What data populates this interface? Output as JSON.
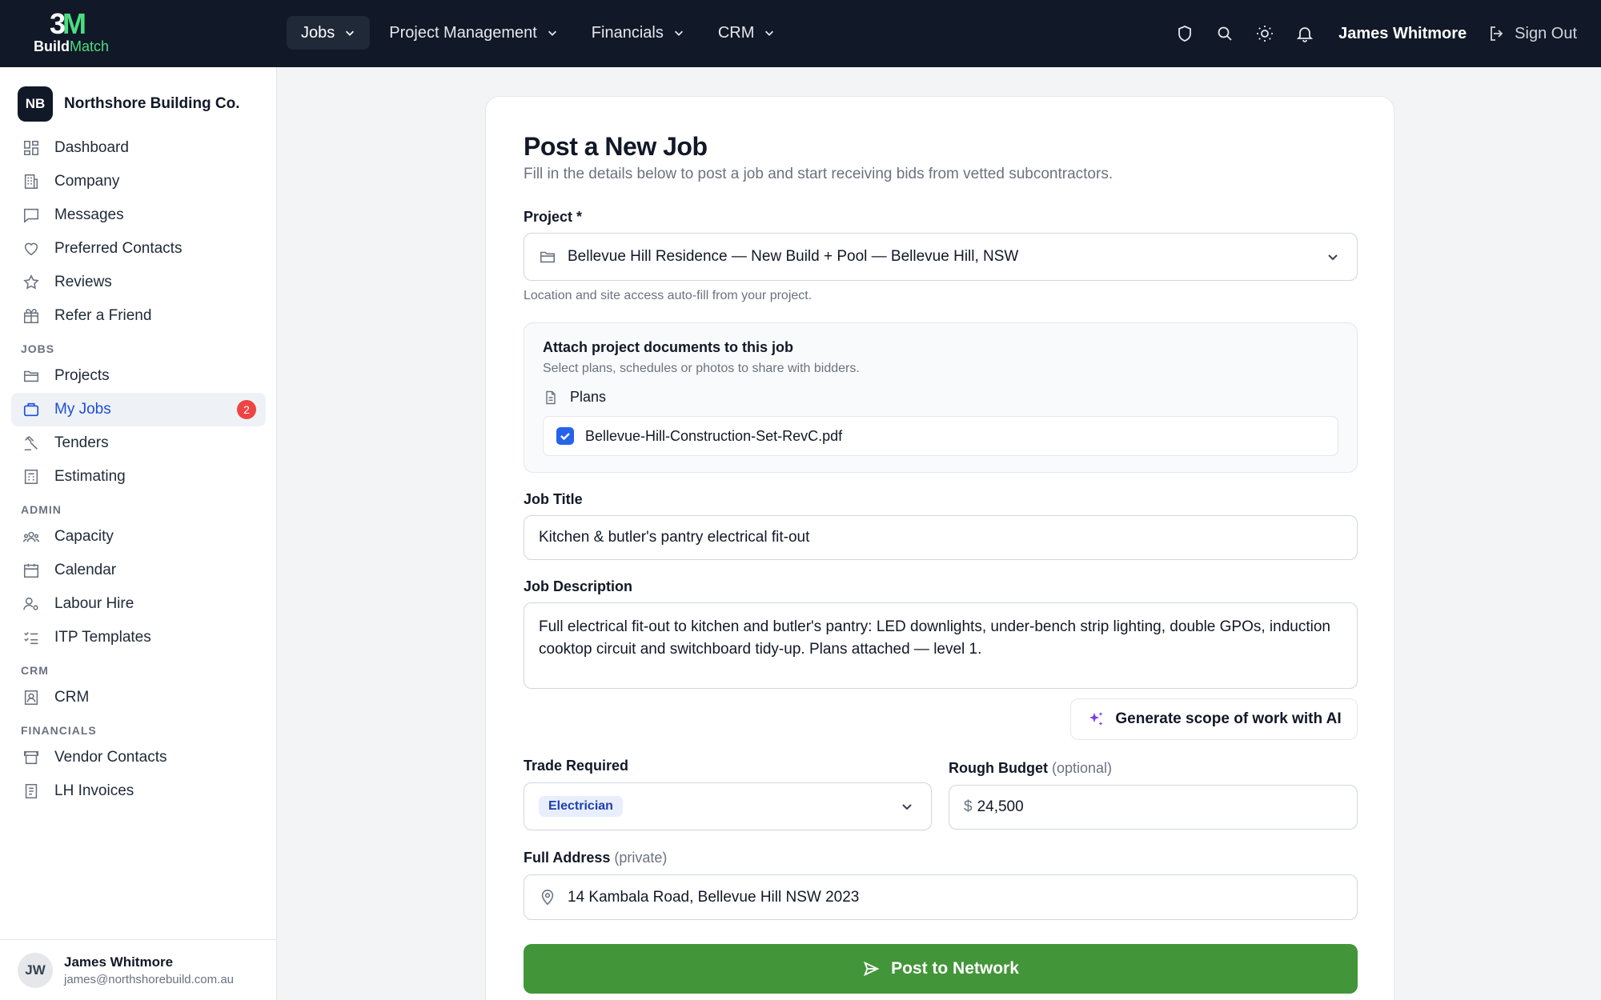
{
  "brand": {
    "mark_left": "3",
    "mark_right": "M",
    "name_left": "Build",
    "name_right": "Match"
  },
  "topnav": {
    "items": [
      {
        "label": "Jobs",
        "active": true
      },
      {
        "label": "Project Management"
      },
      {
        "label": "Financials"
      },
      {
        "label": "CRM"
      }
    ],
    "icons": [
      "shield-icon",
      "search-icon",
      "sun-icon",
      "bell-icon"
    ],
    "user": "James Whitmore",
    "sign_out": "Sign Out"
  },
  "sidebar": {
    "org": {
      "initials": "NB",
      "name": "Northshore Building Co."
    },
    "main_items": [
      {
        "label": "Dashboard",
        "icon": "dashboard-icon"
      },
      {
        "label": "Company",
        "icon": "building-icon"
      },
      {
        "label": "Messages",
        "icon": "message-icon"
      },
      {
        "label": "Preferred Contacts",
        "icon": "heart-icon"
      },
      {
        "label": "Reviews",
        "icon": "star-icon"
      },
      {
        "label": "Refer a Friend",
        "icon": "gift-icon"
      }
    ],
    "sections": {
      "jobs": "JOBS",
      "admin": "ADMIN",
      "crm": "CRM",
      "financials": "FINANCIALS"
    },
    "jobs_items": [
      {
        "label": "Projects",
        "icon": "folder-icon"
      },
      {
        "label": "My Jobs",
        "icon": "briefcase-icon",
        "badge": "2",
        "active": true
      },
      {
        "label": "Tenders",
        "icon": "gavel-icon"
      },
      {
        "label": "Estimating",
        "icon": "calculator-icon"
      }
    ],
    "admin_items": [
      {
        "label": "Capacity",
        "icon": "users-icon"
      },
      {
        "label": "Calendar",
        "icon": "calendar-icon"
      },
      {
        "label": "Labour Hire",
        "icon": "user-cog-icon"
      },
      {
        "label": "ITP Templates",
        "icon": "checklist-icon"
      }
    ],
    "crm_items": [
      {
        "label": "CRM",
        "icon": "contact-icon"
      }
    ],
    "financials_items": [
      {
        "label": "Vendor Contacts",
        "icon": "store-icon"
      },
      {
        "label": "LH Invoices",
        "icon": "receipt-icon"
      }
    ],
    "footer": {
      "initials": "JW",
      "name": "James Whitmore",
      "email": "james@northshorebuild.com.au"
    }
  },
  "form": {
    "title": "Post a New Job",
    "subtitle": "Fill in the details below to post a job and start receiving bids from vetted subcontractors.",
    "project_label": "Project *",
    "project_value": "Bellevue Hill Residence — New Build + Pool — Bellevue Hill, NSW",
    "project_helper": "Location and site access auto-fill from your project.",
    "docs": {
      "title": "Attach project documents to this job",
      "subtitle": "Select plans, schedules or photos to share with bidders.",
      "category": "Plans",
      "file": "Bellevue-Hill-Construction-Set-RevC.pdf",
      "checked": true
    },
    "job_title_label": "Job Title",
    "job_title_value": "Kitchen & butler's pantry electrical fit-out",
    "desc_label": "Job Description",
    "desc_value": "Full electrical fit-out to kitchen and butler's pantry: LED downlights, under-bench strip lighting, double GPOs, induction cooktop circuit and switchboard tidy-up. Plans attached — level 1.",
    "ai_button": "Generate scope of work with AI",
    "trade_label": "Trade Required",
    "trade_value": "Electrician",
    "budget_label": "Rough Budget",
    "budget_optional": "(optional)",
    "budget_currency": "$",
    "budget_value": "24,500",
    "address_label": "Full Address",
    "address_private": "(private)",
    "address_value": "14 Kambala Road, Bellevue Hill NSW 2023",
    "submit": "Post to Network"
  },
  "colors": {
    "nav_bg": "#111827",
    "accent_green": "#43953a",
    "brand_green": "#4ade80",
    "active_blue": "#1d4ed8",
    "badge_red": "#ef4444"
  }
}
